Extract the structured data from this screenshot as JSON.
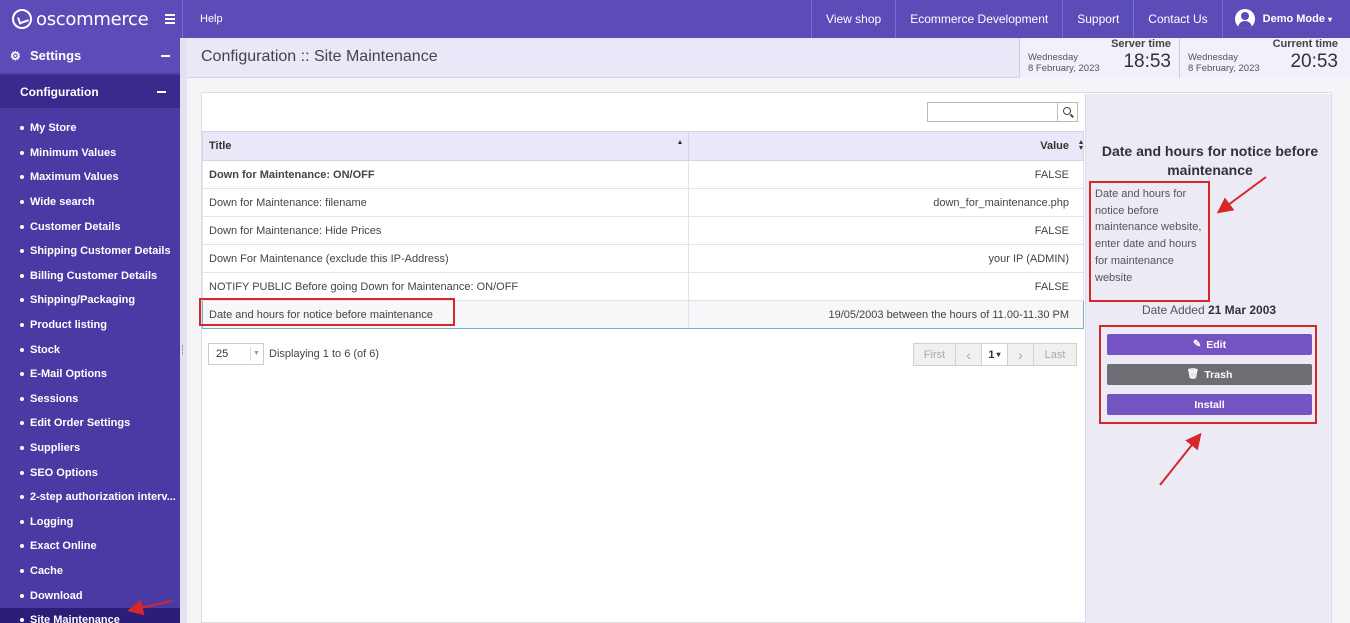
{
  "topbar": {
    "logo_text": "oscommerce",
    "help": "Help",
    "nav": [
      "View shop",
      "Ecommerce Development",
      "Support",
      "Contact Us"
    ],
    "user": "Demo Mode"
  },
  "sidebar": {
    "header": "Settings",
    "section": "Configuration",
    "items": [
      "My Store",
      "Minimum Values",
      "Maximum Values",
      "Wide search",
      "Customer Details",
      "Shipping Customer Details",
      "Billing Customer Details",
      "Shipping/Packaging",
      "Product listing",
      "Stock",
      "E-Mail Options",
      "Sessions",
      "Edit Order Settings",
      "Suppliers",
      "SEO Options",
      "2-step authorization interv...",
      "Logging",
      "Exact Online",
      "Cache",
      "Download",
      "Site Maintenance"
    ],
    "active_index": 20
  },
  "header": {
    "title": "Configuration :: Site Maintenance",
    "server_time": {
      "label": "Server time",
      "day": "Wednesday",
      "date": "8 February, 2023",
      "time": "18:53"
    },
    "current_time": {
      "label": "Current time",
      "day": "Wednesday",
      "date": "8 February, 2023",
      "time": "20:53"
    }
  },
  "table": {
    "columns": [
      "Title",
      "Value"
    ],
    "rows": [
      {
        "title": "Down for Maintenance: ON/OFF",
        "value": "FALSE"
      },
      {
        "title": "Down for Maintenance: filename",
        "value": "down_for_maintenance.php"
      },
      {
        "title": "Down for Maintenance: Hide Prices",
        "value": "FALSE"
      },
      {
        "title": "Down For Maintenance (exclude this IP-Address)",
        "value": "your IP (ADMIN)"
      },
      {
        "title": "NOTIFY PUBLIC Before going Down for Maintenance: ON/OFF",
        "value": "FALSE"
      },
      {
        "title": "Date and hours for notice before maintenance",
        "value": "19/05/2003 between the hours of 11.00-11.30 PM"
      }
    ]
  },
  "pager": {
    "page_size": "25",
    "info": "Displaying 1 to 6 (of 6)",
    "first": "First",
    "page": "1",
    "last": "Last"
  },
  "info": {
    "title": "Date and hours for notice before maintenance",
    "description": "Date and hours for notice before maintenance website, enter date and hours for maintenance website",
    "date_label": "Date Added",
    "date_value": "21 Mar 2003",
    "buttons": {
      "edit": "Edit",
      "trash": "Trash",
      "install": "Install"
    }
  },
  "colors": {
    "brand": "#5b4cb8",
    "sidebar": "#4a3aa3",
    "annotation": "#d62828"
  }
}
